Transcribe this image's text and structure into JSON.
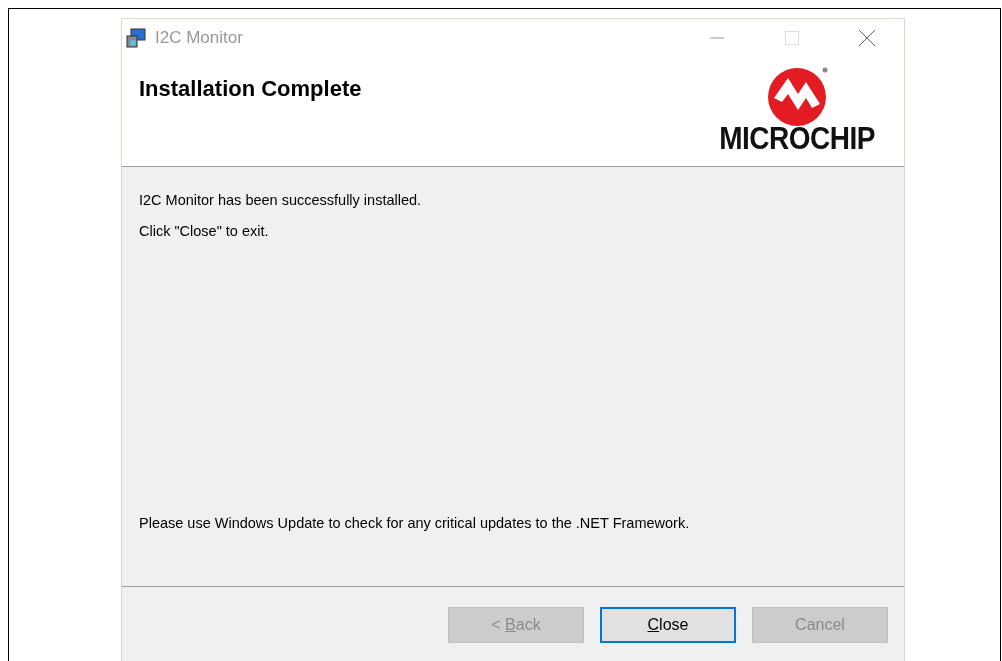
{
  "window": {
    "title": "I2C Monitor"
  },
  "header": {
    "title": "Installation Complete",
    "logo_text": "MICROCHIP"
  },
  "body": {
    "messages": [
      "I2C Monitor has been successfully installed.",
      "Click \"Close\" to exit."
    ],
    "footer_note": "Please use Windows Update to check for any critical updates to the .NET Framework."
  },
  "buttons": [
    {
      "before": "< ",
      "key": "B",
      "after": "ack",
      "disabled": true,
      "focused": false
    },
    {
      "key": "C",
      "after": "lose",
      "disabled": false,
      "focused": true
    },
    {
      "before": "Cancel",
      "disabled": true,
      "focused": false
    }
  ]
}
